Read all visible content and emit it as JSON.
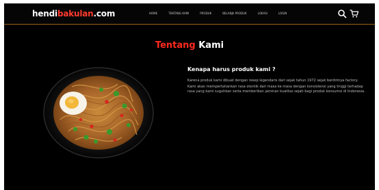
{
  "brand": {
    "part1": "hendi",
    "part2": "bakulan",
    "part3": ".com",
    "accent_color": "#ff3b30"
  },
  "nav": {
    "items": [
      "Home",
      "Tentang Kami",
      "Produk",
      "Belanja Produk",
      "Lokasi",
      "Login"
    ],
    "icons": [
      "search-icon",
      "cart-icon"
    ]
  },
  "section": {
    "title_accent": "Tentang",
    "title_rest": "Kami",
    "accent_color": "#ff2a1f"
  },
  "content": {
    "heading": "Kenapa harus produk kami ?",
    "paragraph1": "Karena produk kami dibuat dengan resep legendaris dari sejak tahun 1972 sejak berdirinya factory.",
    "paragraph2": "Kami akan mempertahankan rasa otentik dari masa ke masa dengan konsistensi yang tinggi terhadap rasa yang kami suguhkan serta memberikan jaminan kualitas sejati bagi produk konsumsi di Indonesia."
  },
  "colors": {
    "background": "#000000",
    "navbar_border": "#9a6418"
  }
}
